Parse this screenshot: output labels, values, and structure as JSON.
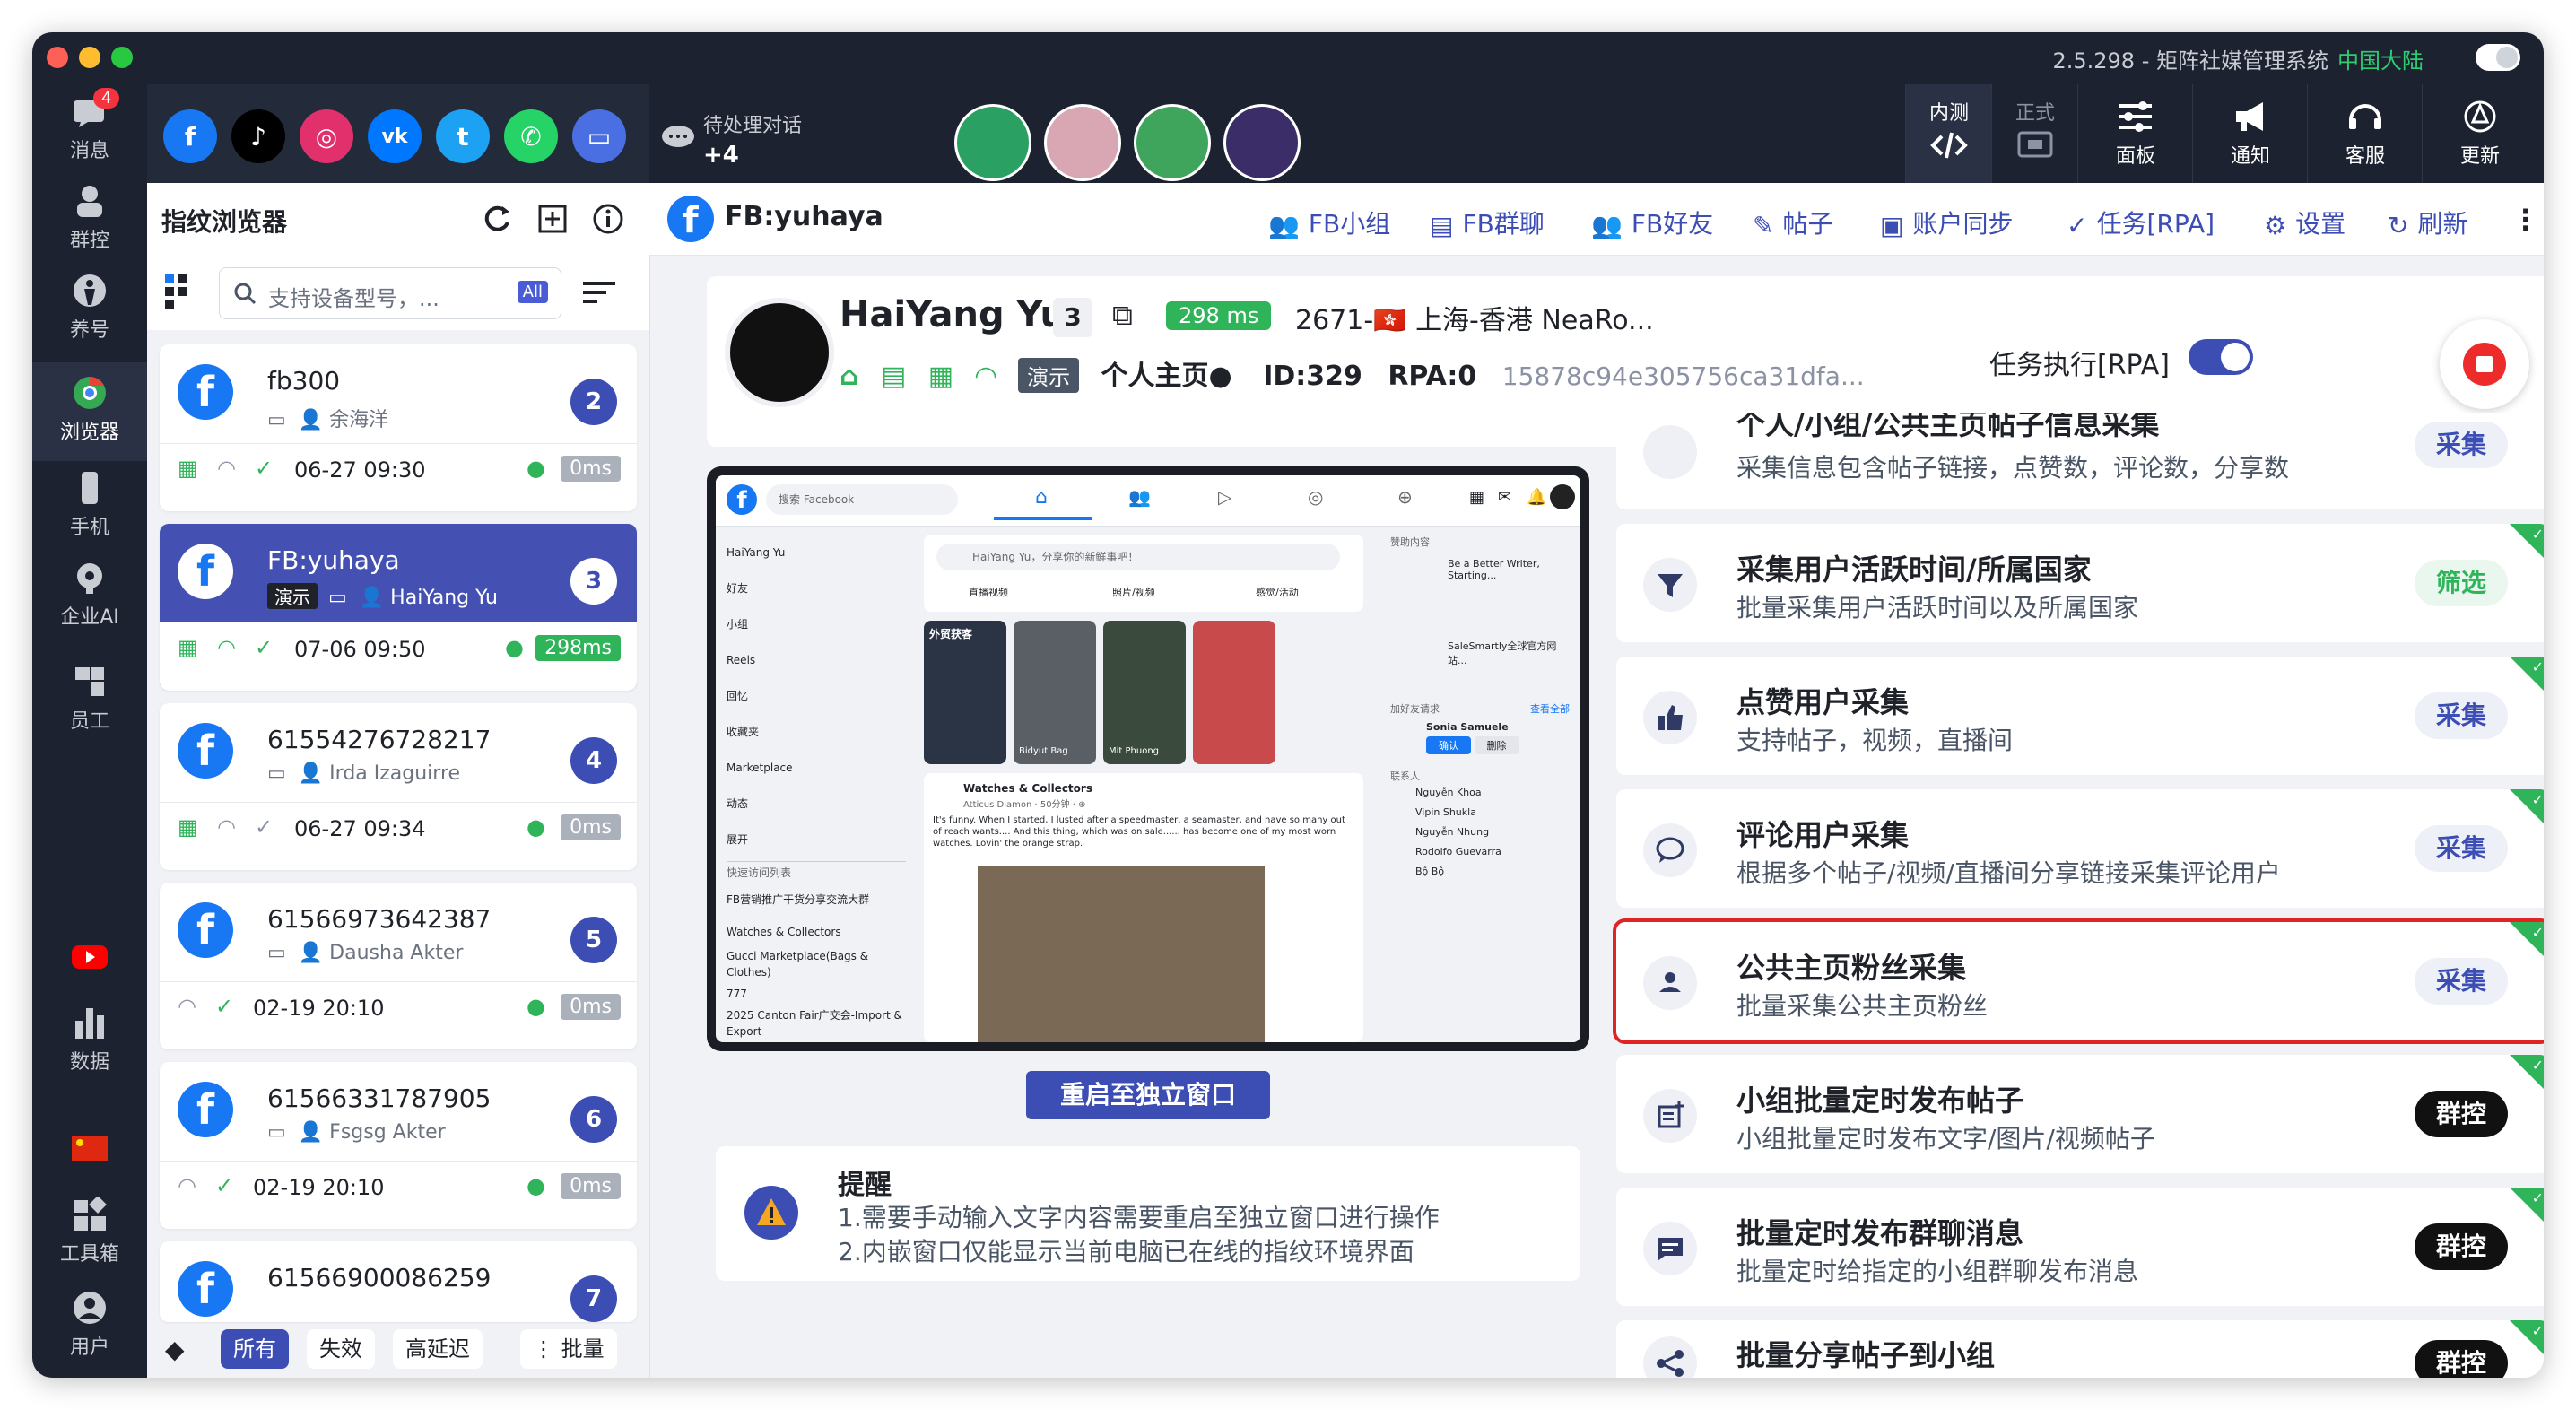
{
  "window": {
    "title": "2.5.298 - 矩阵社媒管理系统",
    "region": "中国大陆"
  },
  "rail": {
    "items": [
      {
        "label": "消息",
        "icon": "message-icon",
        "badge": "4"
      },
      {
        "label": "群控",
        "icon": "group-control-icon"
      },
      {
        "label": "养号",
        "icon": "nurture-account-icon"
      },
      {
        "label": "浏览器",
        "icon": "chrome-browser-icon"
      },
      {
        "label": "手机",
        "icon": "phone-icon"
      },
      {
        "label": "企业AI",
        "icon": "enterprise-ai-icon"
      },
      {
        "label": "员工",
        "icon": "staff-icon"
      },
      {
        "label": "",
        "icon": "youtube-icon"
      },
      {
        "label": "数据",
        "icon": "data-chart-icon"
      },
      {
        "label": "",
        "icon": "china-flag-icon"
      },
      {
        "label": "工具箱",
        "icon": "toolbox-icon"
      },
      {
        "label": "用户",
        "icon": "user-icon"
      }
    ]
  },
  "topbar": {
    "pending_label": "待处理对话",
    "pending_count": "+4",
    "actions": [
      {
        "label": "内测",
        "sub": "",
        "icon": "code-icon"
      },
      {
        "label": "正式",
        "sub": "",
        "icon": "terminal-icon"
      },
      {
        "label": "面板",
        "icon": "sliders-icon"
      },
      {
        "label": "通知",
        "icon": "megaphone-icon"
      },
      {
        "label": "客服",
        "icon": "headset-icon"
      },
      {
        "label": "更新",
        "icon": "update-icon"
      }
    ]
  },
  "listpanel": {
    "title": "指纹浏览器",
    "search_placeholder": "支持设备型号，...",
    "search_scope": "All",
    "cards": [
      {
        "name": "fb300",
        "owner": "余海洋",
        "num": "2",
        "time": "06-27 09:30",
        "ms": "0ms",
        "active": false
      },
      {
        "name": "FB:yuhaya",
        "owner": "HaiYang Yu",
        "demo": "演示",
        "num": "3",
        "time": "07-06 09:50",
        "ms": "298ms",
        "active": true
      },
      {
        "name": "61554276728217",
        "owner": "Irda Izaguirre",
        "num": "4",
        "time": "06-27 09:34",
        "ms": "0ms",
        "active": false
      },
      {
        "name": "61566973642387",
        "owner": "Dausha Akter",
        "num": "5",
        "time": "02-19 20:10",
        "ms": "0ms",
        "active": false
      },
      {
        "name": "61566331787905",
        "owner": "Fsgsg Akter",
        "num": "6",
        "time": "02-19 20:10",
        "ms": "0ms",
        "active": false
      },
      {
        "name": "61566900086259",
        "owner": "",
        "num": "7",
        "time": "",
        "ms": "",
        "active": false
      }
    ],
    "filters": [
      "所有",
      "失效",
      "高延迟"
    ],
    "batch_label": "批量"
  },
  "main": {
    "tab_title": "FB:yuhaya",
    "nav": [
      "FB小组",
      "FB群聊",
      "FB好友",
      "帖子",
      "账户同步",
      "任务[RPA]",
      "设置",
      "刷新"
    ]
  },
  "profile": {
    "name": "HaiYang Yu",
    "count": "3",
    "ms": "298 ms",
    "location": "2671-🇭🇰 上海-香港 NeaRo...",
    "demo": "演示",
    "home": "个人主页●",
    "id": "ID:329",
    "rpa": "RPA:0",
    "hash": "15878c94e305756ca31dfa...",
    "task_label": "任务执行[RPA]"
  },
  "preview": {
    "search_placeholder": "搜索 Facebook",
    "left_items": [
      "HaiYang Yu",
      "好友",
      "小组",
      "Reels",
      "回忆",
      "收藏夹",
      "Marketplace",
      "动态",
      "展开"
    ],
    "shortcuts_title": "快速访问列表",
    "shortcuts": [
      "FB营销推广干货分享交流大群",
      "Watches & Collectors",
      "Gucci Marketplace(Bags & Clothes)",
      "777",
      "2025 Canton Fair广交会-Import & Export"
    ],
    "composer_placeholder": "HaiYang Yu，分享你的新鲜事吧！",
    "composer_actions": [
      "直播视频",
      "照片/视频",
      "感觉/活动"
    ],
    "stories": [
      "外贸获客",
      "Bidyut Bag",
      "Mit Phuong",
      ""
    ],
    "post_group": "Watches & Collectors",
    "post_author": "Atticus Diamon · 50分钟 · ⊕",
    "post_text": "It's funny. When I started, I lusted after a speedmaster, a seamaster, and have so many out of reach wants.... And this thing, which was on sale...... has become one of my most worn watches. Lovin' the orange strap.",
    "sponsored": "赞助内容",
    "ads": [
      "Be a Better Writer, Starting...",
      "SaleSmartly全球官方网站..."
    ],
    "friend_requests": "加好友请求",
    "view_all": "查看全部",
    "request_name": "Sonia Samuele",
    "confirm": "确认",
    "delete": "删除",
    "contacts_title": "联系人",
    "contacts": [
      "Nguyễn Khoa",
      "Vipin Shukla",
      "Nguyễn Nhung",
      "Rodolfo Guevarra",
      "Bộ Bộ"
    ],
    "restart_button": "重启至独立窗口"
  },
  "reminder": {
    "title": "提醒",
    "line1": "1.需要手动输入文字内容需要重启至独立窗口进行操作",
    "line2": "2.内嵌窗口仅能显示当前电脑已在线的指纹环境界面"
  },
  "features": [
    {
      "title": "个人/小组/公共主页帖子信息采集",
      "desc": "采集信息包含帖子链接，点赞数，评论数，分享数",
      "btn": "采集",
      "dark": false,
      "icon": "list-doc-icon"
    },
    {
      "title": "采集用户活跃时间/所属国家",
      "desc": "批量采集用户活跃时间以及所属国家",
      "btn": "筛选",
      "dark": false,
      "icon": "funnel-icon"
    },
    {
      "title": "点赞用户采集",
      "desc": "支持帖子，视频，直播间",
      "btn": "采集",
      "dark": false,
      "icon": "thumbs-up-icon"
    },
    {
      "title": "评论用户采集",
      "desc": "根据多个帖子/视频/直播间分享链接采集评论用户",
      "btn": "采集",
      "dark": false,
      "icon": "comment-icon"
    },
    {
      "title": "公共主页粉丝采集",
      "desc": "批量采集公共主页粉丝",
      "btn": "采集",
      "dark": false,
      "icon": "person-icon",
      "highlight": true
    },
    {
      "title": "小组批量定时发布帖子",
      "desc": "小组批量定时发布文字/图片/视频帖子",
      "btn": "群控",
      "dark": true,
      "icon": "post-add-icon"
    },
    {
      "title": "批量定时发布群聊消息",
      "desc": "批量定时给指定的小组群聊发布消息",
      "btn": "群控",
      "dark": true,
      "icon": "chat-box-icon"
    },
    {
      "title": "批量分享帖子到小组",
      "desc": "",
      "btn": "群控",
      "dark": true,
      "icon": "share-icon"
    }
  ],
  "colors": {
    "accent": "#3c4db4",
    "dark_bg": "#1d2230",
    "success": "#2fb45a",
    "danger": "#e02424"
  }
}
